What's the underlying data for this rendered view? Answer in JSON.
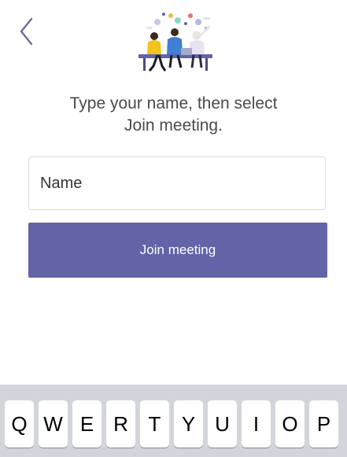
{
  "nav": {
    "back_icon": "chevron-left-icon"
  },
  "illustration": {
    "icon": "meeting-people-illustration"
  },
  "instruction": {
    "line1": "Type your name, then select",
    "line2": "Join meeting."
  },
  "name_field": {
    "placeholder": "Name",
    "value": ""
  },
  "join_button": {
    "label": "Join meeting"
  },
  "keyboard": {
    "keys": [
      "Q",
      "W",
      "E",
      "R",
      "T",
      "Y",
      "U",
      "I",
      "O",
      "P"
    ]
  },
  "colors": {
    "accent": "#6264a7",
    "keyboard_bg": "#d2d5db",
    "back_icon": "#6264a7"
  }
}
